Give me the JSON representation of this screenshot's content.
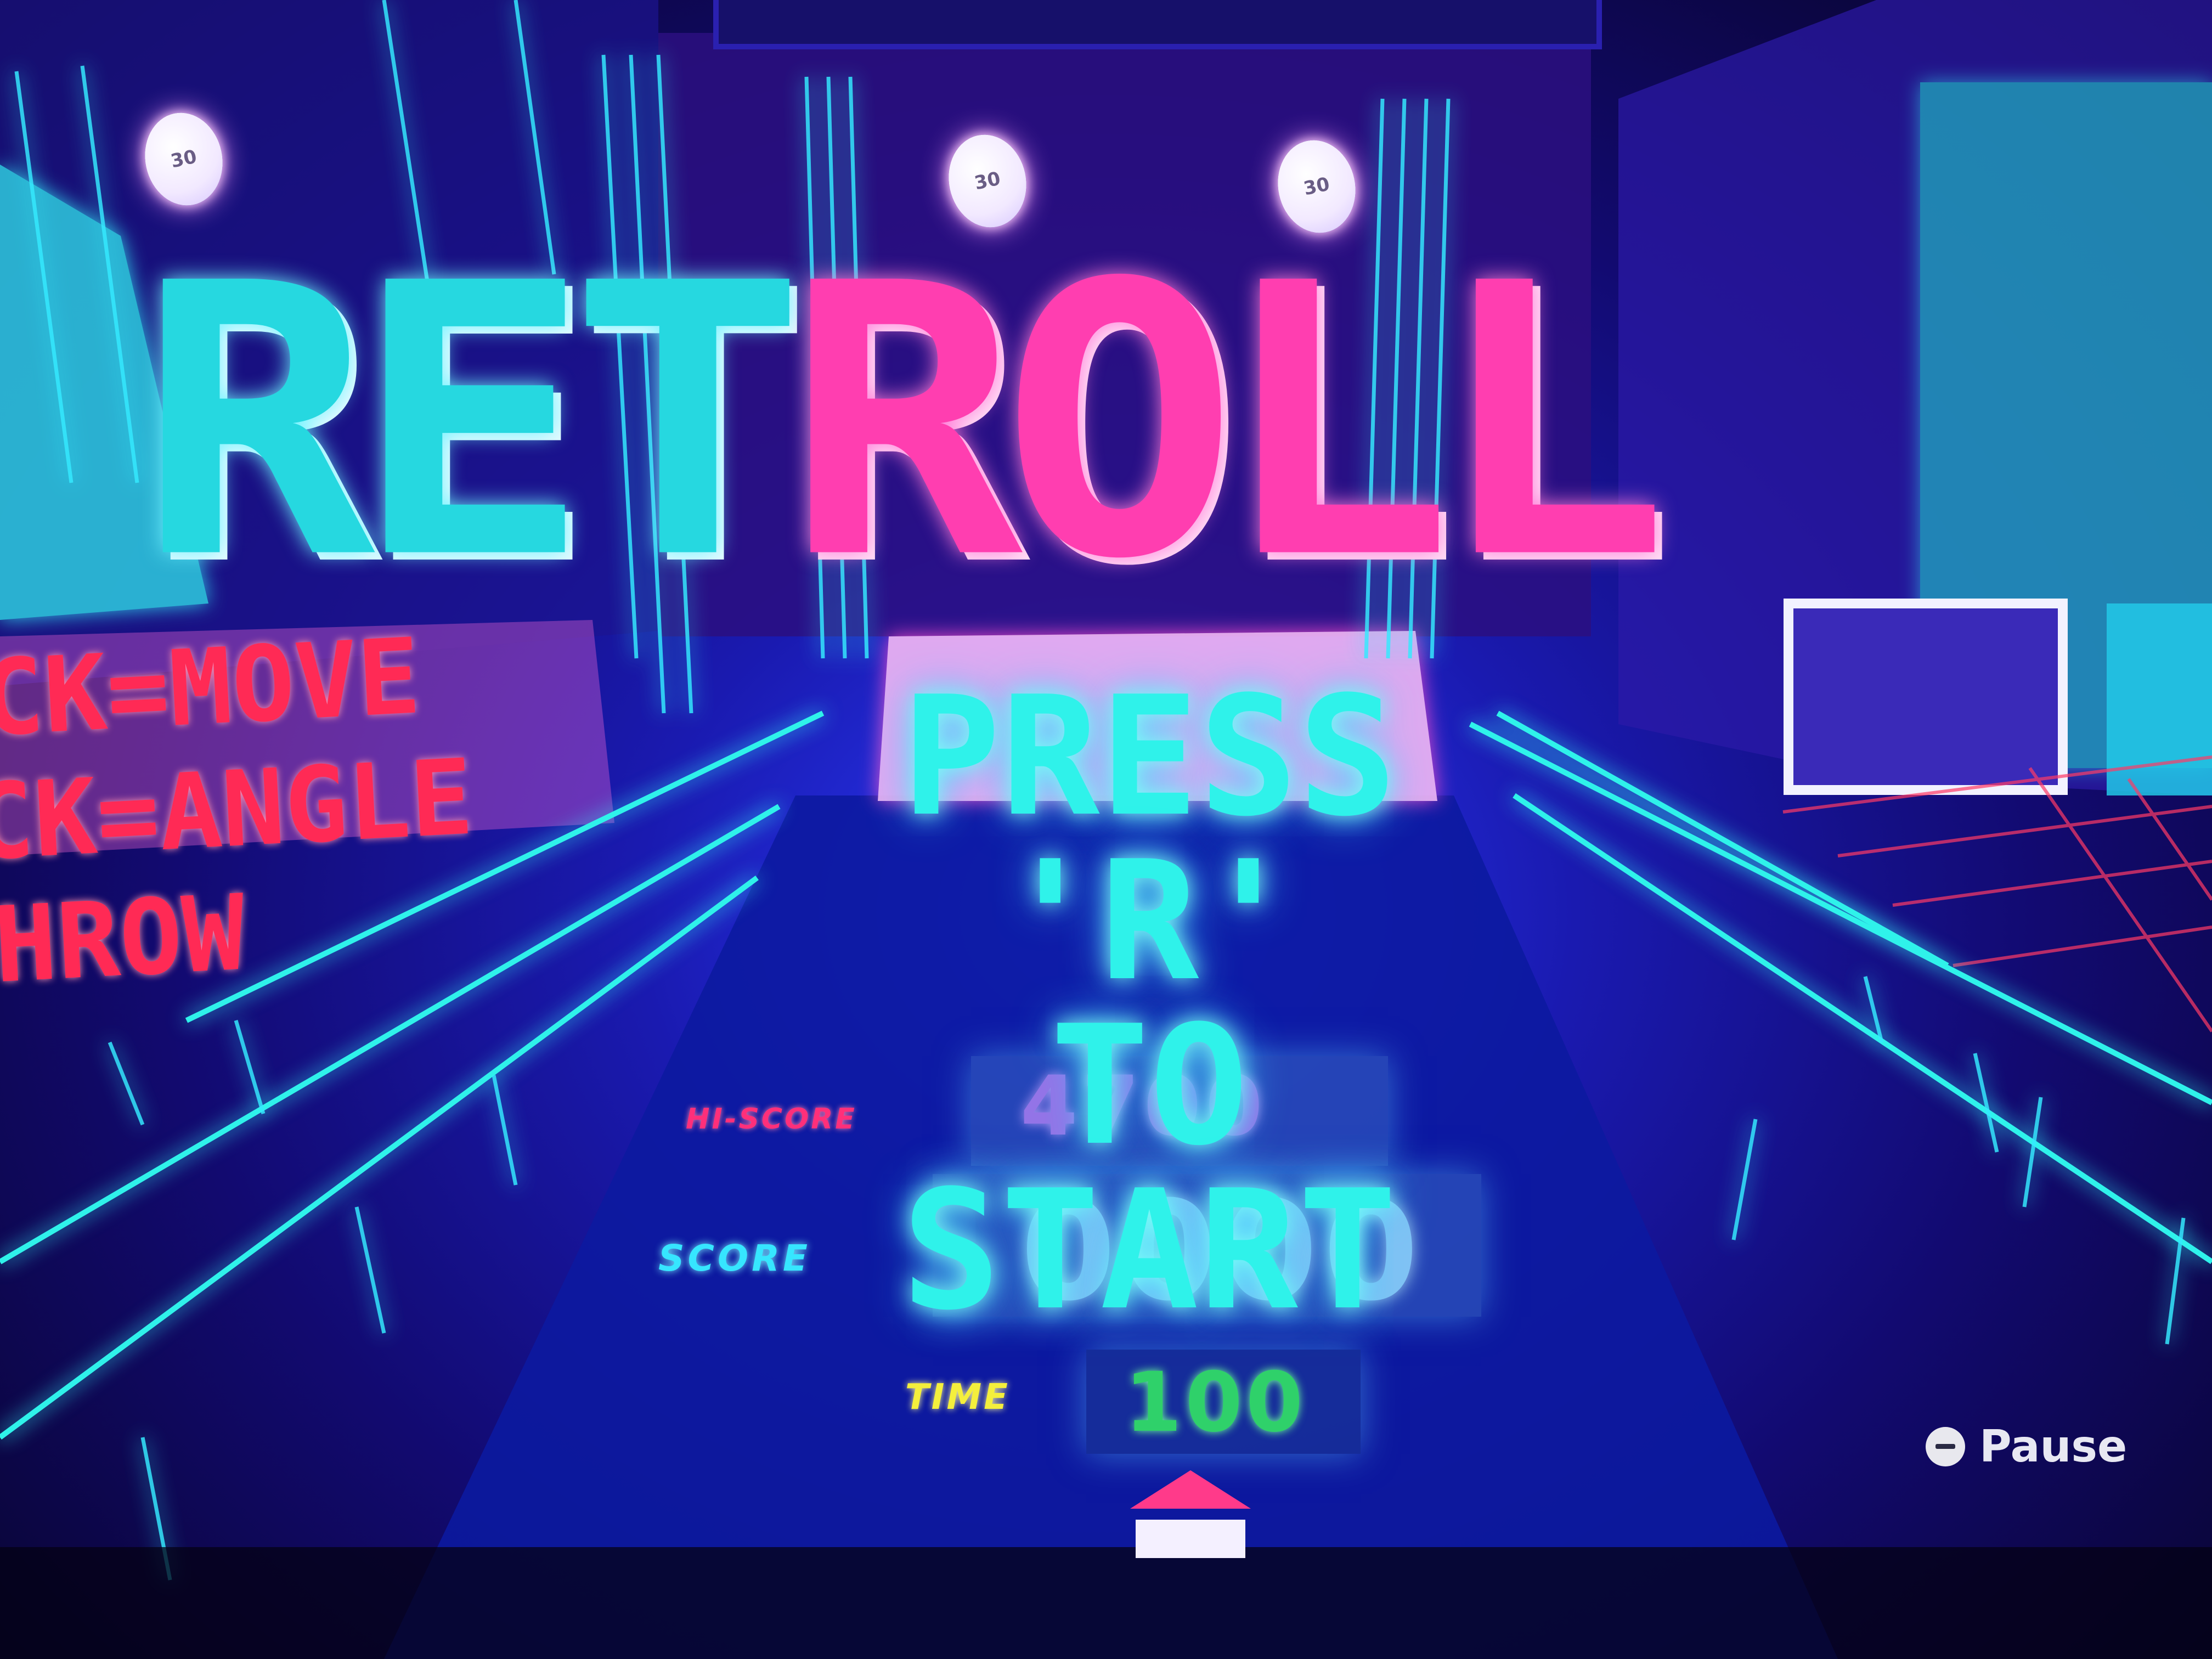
{
  "title": {
    "part_a": "RET",
    "part_b": "ROLL"
  },
  "balls": [
    {
      "label": "30"
    },
    {
      "label": "30"
    },
    {
      "label": "30"
    }
  ],
  "instructions": [
    "CK=MOVE",
    "CK=ANGLE",
    "HROW"
  ],
  "hud": {
    "hiscore_label": "HI-SCORE",
    "hiscore_value": "4700",
    "score_label": "SCORE",
    "score_value": "0000",
    "time_label": "TIME",
    "time_value": "100"
  },
  "prompt": {
    "lines": [
      "PRESS",
      "'R'",
      "TO",
      "START"
    ]
  },
  "pause": {
    "icon": "minus-button-icon",
    "label": "Pause"
  },
  "colors": {
    "cyan": "#2ff2ea",
    "pink": "#ff3eb0",
    "red": "#ff2a55",
    "yellow": "#f4ef3c",
    "green": "#2fd16a",
    "background": "#1a1ab0"
  }
}
